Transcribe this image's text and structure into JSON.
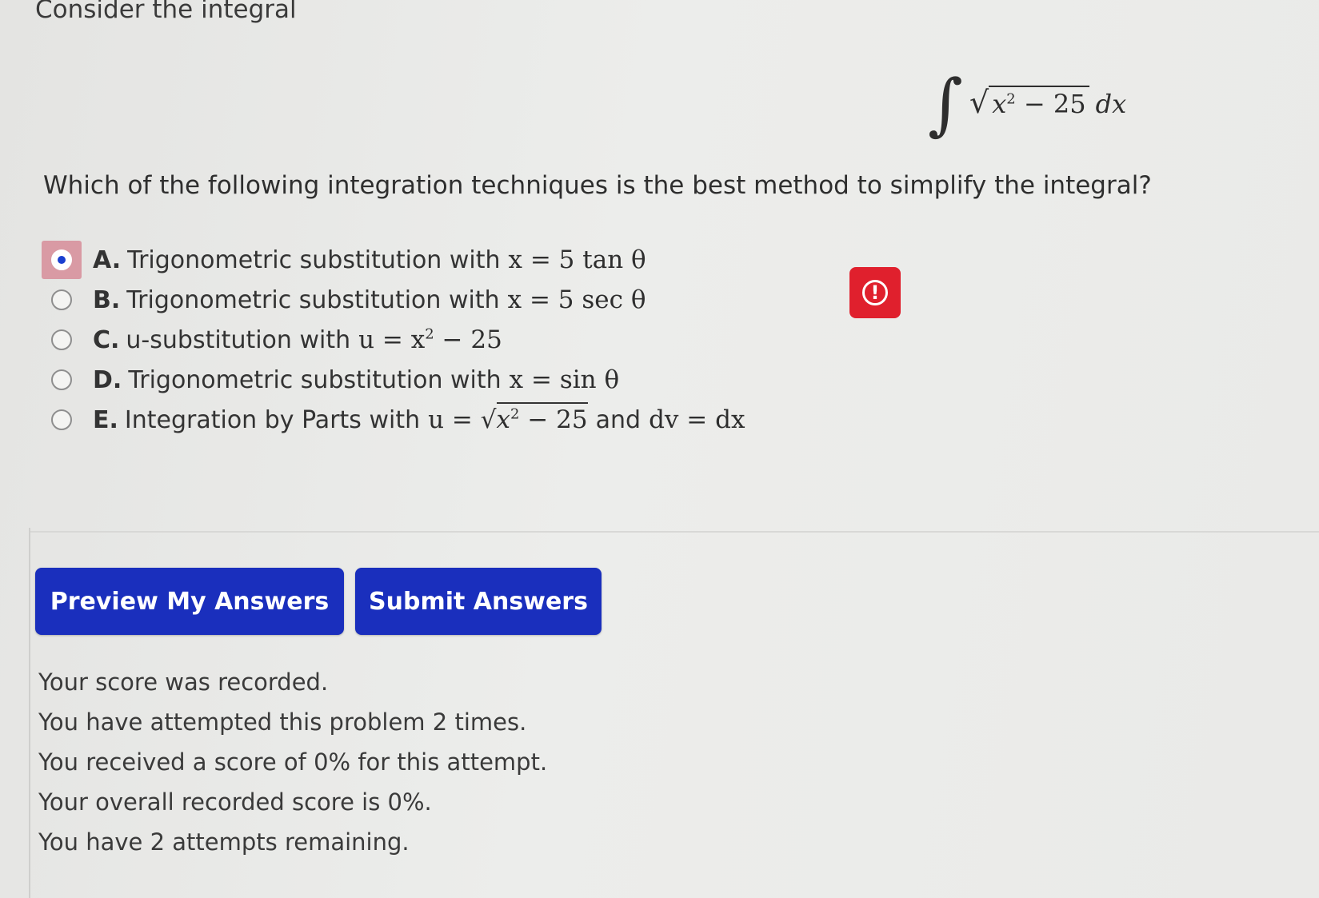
{
  "prompt": "Consider the integral",
  "integral": {
    "sign": "∫",
    "sqrt": "√",
    "var": "x",
    "power": "2",
    "minus_const": " − 25",
    "differential": "dx"
  },
  "question": "Which of the following integration techniques is the best method to simplify the integral?",
  "options": [
    {
      "letter": "A.",
      "text": "Trigonometric substitution with",
      "math": "x = 5 tan θ",
      "selected": true
    },
    {
      "letter": "B.",
      "text": "Trigonometric substitution with",
      "math": "x = 5 sec θ",
      "selected": false
    },
    {
      "letter": "C.",
      "text": "u-substitution with",
      "math_prefix": "u = x",
      "math_sup": "2",
      "math_suffix": " − 25",
      "selected": false
    },
    {
      "letter": "D.",
      "text": "Trigonometric substitution with",
      "math": "x = sin θ",
      "selected": false
    },
    {
      "letter": "E.",
      "text": "Integration by Parts with",
      "math_prefix": "u = ",
      "sqrt": "√",
      "rad_var": "x",
      "rad_sup": "2",
      "rad_rest": " − 25",
      "and": "and",
      "math_suffix": "dv = dx",
      "selected": false
    }
  ],
  "feedback_icon": "alert-circle-icon",
  "feedback_symbol": "!",
  "feedback_color": "#e0202d",
  "buttons": {
    "preview": "Preview My Answers",
    "submit": "Submit Answers"
  },
  "button_color": "#1a2fbd",
  "status": [
    "Your score was recorded.",
    "You have attempted this problem 2 times.",
    "You received a score of 0% for this attempt.",
    "Your overall recorded score is 0%.",
    "You have 2 attempts remaining."
  ]
}
